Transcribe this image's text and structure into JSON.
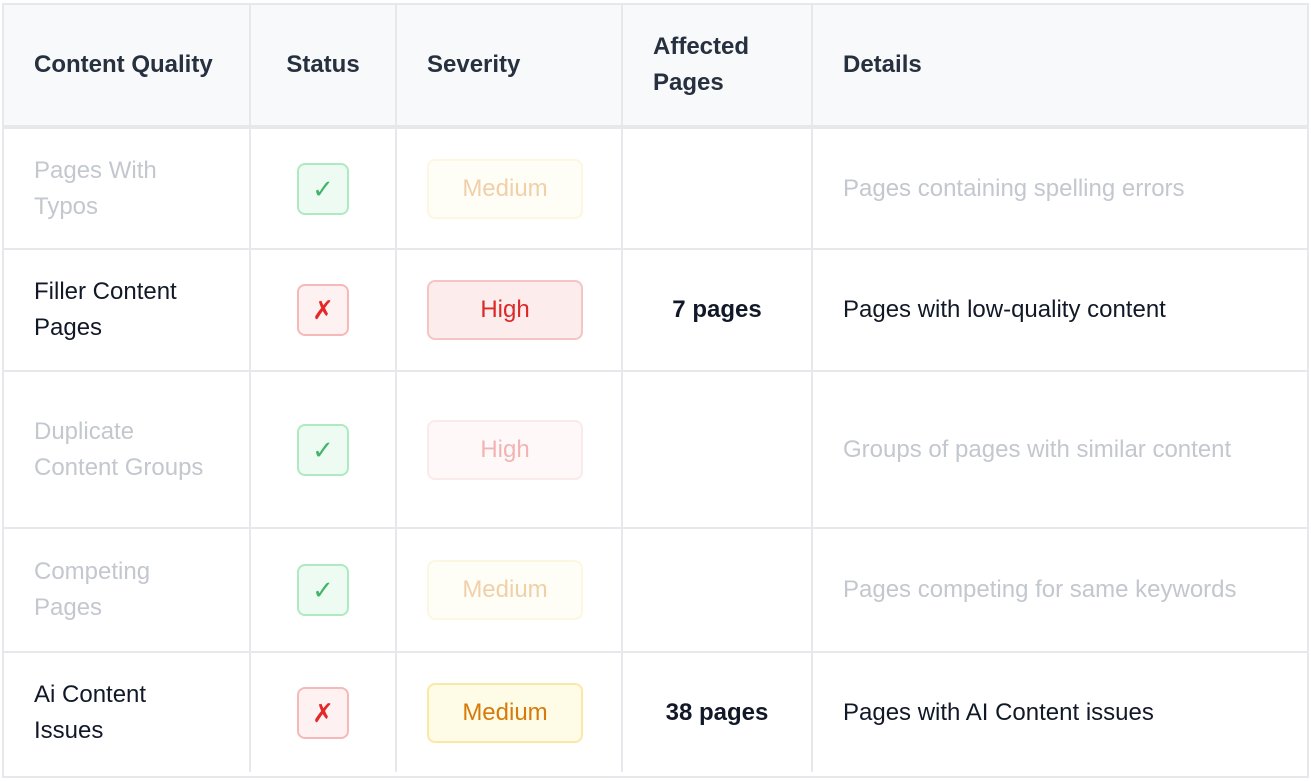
{
  "table": {
    "headers": {
      "name": "Content Quality",
      "status": "Status",
      "severity": "Severity",
      "affected": "Affected Pages",
      "details": "Details"
    },
    "rows": [
      {
        "name": "Pages With Typos",
        "status": "✓",
        "status_state": "pass",
        "severity": "Medium",
        "affected": "",
        "details": "Pages containing spelling errors"
      },
      {
        "name": "Filler Content Pages",
        "status": "✗",
        "status_state": "fail",
        "severity": "High",
        "affected": "7 pages",
        "details": "Pages with low-quality content"
      },
      {
        "name": "Duplicate Content Groups",
        "status": "✓",
        "status_state": "pass",
        "severity": "High",
        "affected": "",
        "details": "Groups of pages with similar content"
      },
      {
        "name": "Competing Pages",
        "status": "✓",
        "status_state": "pass",
        "severity": "Medium",
        "affected": "",
        "details": "Pages competing for same keywords"
      },
      {
        "name": "Ai Content Issues",
        "status": "✗",
        "status_state": "fail",
        "severity": "Medium",
        "affected": "38 pages",
        "details": "Pages with AI Content issues"
      }
    ]
  },
  "colors": {
    "pass": "#2fae5c",
    "fail": "#e52727",
    "severity_high": "#dc2828",
    "severity_medium": "#d67b0a"
  }
}
